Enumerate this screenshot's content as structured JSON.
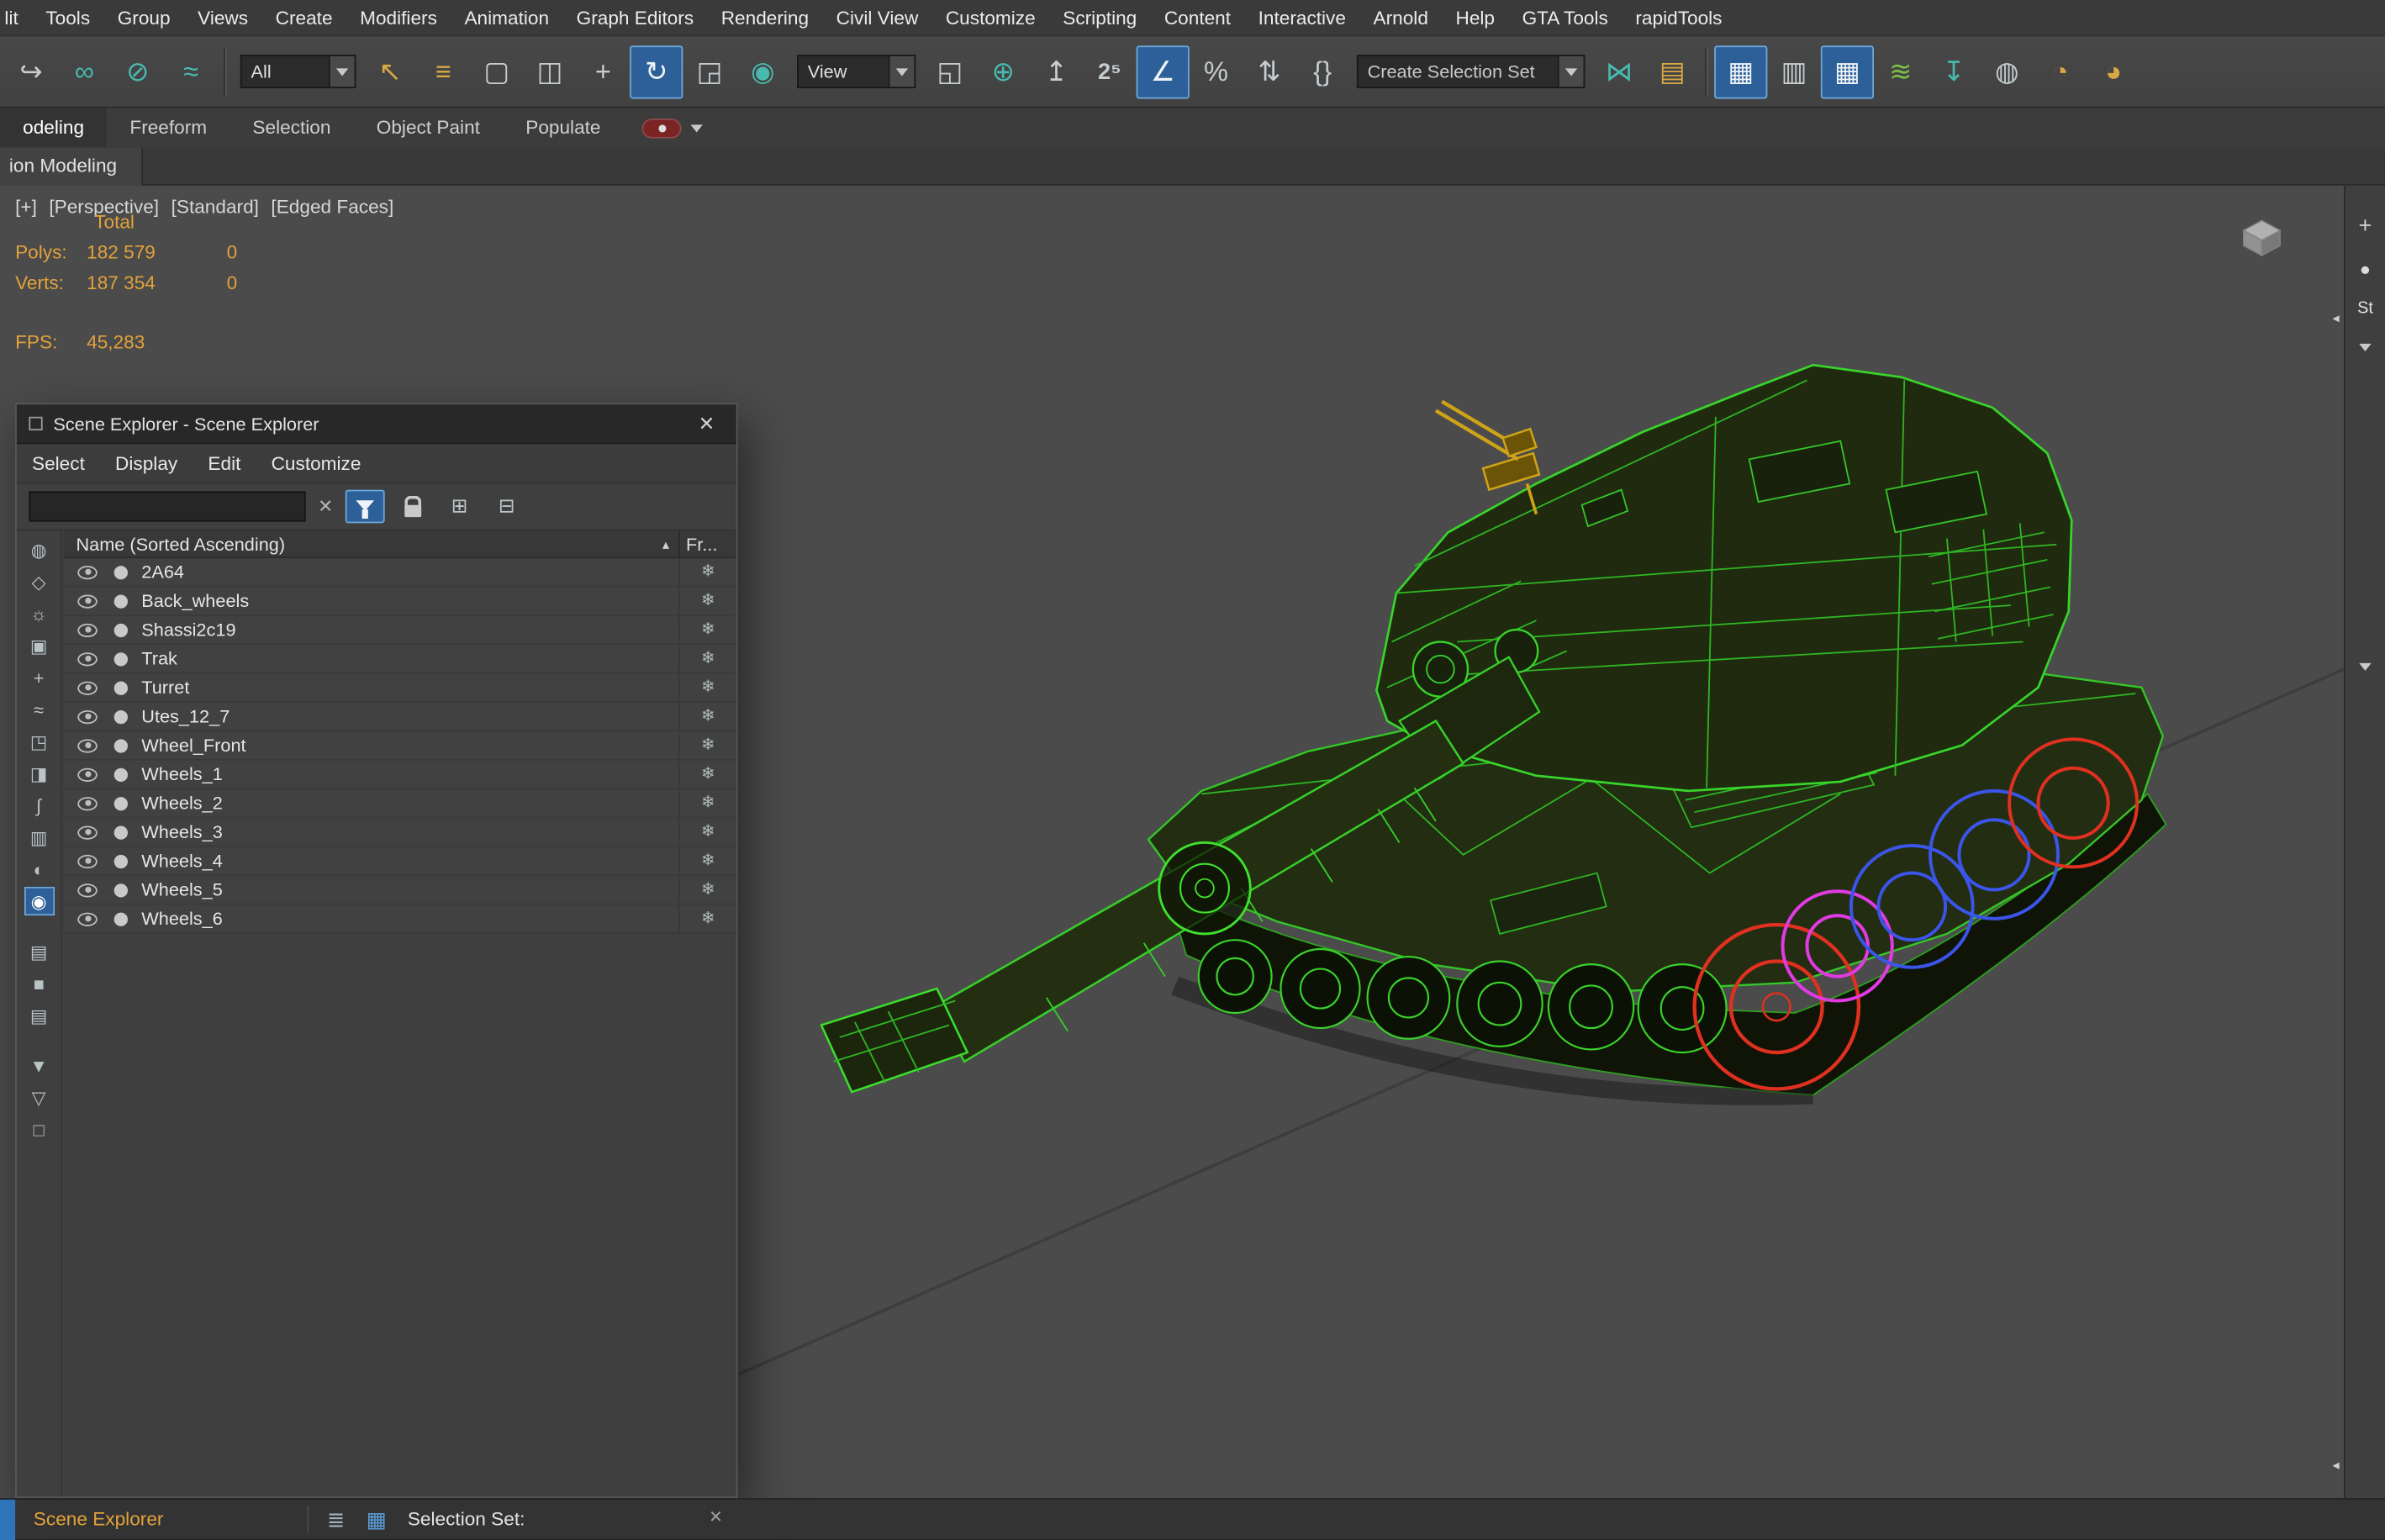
{
  "menubar": {
    "items": [
      "lit",
      "Tools",
      "Group",
      "Views",
      "Create",
      "Modifiers",
      "Animation",
      "Graph Editors",
      "Rendering",
      "Civil View",
      "Customize",
      "Scripting",
      "Content",
      "Interactive",
      "Arnold",
      "Help",
      "GTA Tools",
      "rapidTools"
    ]
  },
  "toolbar": {
    "group1": [
      {
        "name": "redo-icon",
        "glyph": "↪",
        "cls": ""
      },
      {
        "name": "select-and-link-icon",
        "glyph": "∞",
        "cls": "teal"
      },
      {
        "name": "unlink-selection-icon",
        "glyph": "⊘",
        "cls": "teal"
      },
      {
        "name": "bind-to-spacewarp-icon",
        "glyph": "≈",
        "cls": "teal"
      }
    ],
    "selection_filter_value": "All",
    "group2": [
      {
        "name": "select-object-icon",
        "glyph": "↖",
        "cls": "gold"
      },
      {
        "name": "select-by-name-icon",
        "glyph": "≡",
        "cls": "gold"
      },
      {
        "name": "rectangular-selection-region-icon",
        "glyph": "▢",
        "cls": ""
      },
      {
        "name": "window-crossing-icon",
        "glyph": "◫",
        "cls": ""
      },
      {
        "name": "select-and-move-icon",
        "glyph": "+",
        "cls": ""
      },
      {
        "name": "select-and-rotate-icon",
        "glyph": "↻",
        "cls": "active"
      },
      {
        "name": "select-and-scale-icon",
        "glyph": "◲",
        "cls": ""
      },
      {
        "name": "select-placement-icon",
        "glyph": "◉",
        "cls": "teal"
      }
    ],
    "coord_system_value": "View",
    "group3": [
      {
        "name": "use-pivot-point-center-icon",
        "glyph": "◱",
        "cls": ""
      },
      {
        "name": "select-and-manipulate-icon",
        "glyph": "⊕",
        "cls": "teal"
      },
      {
        "name": "keyboard-shortcut-override-icon",
        "glyph": "↥",
        "cls": ""
      },
      {
        "name": "snap-toggle-25-icon",
        "glyph": "2⁵",
        "cls": "snaplbl"
      },
      {
        "name": "angle-snap-icon",
        "glyph": "∠",
        "cls": "active"
      },
      {
        "name": "percent-snap-icon",
        "glyph": "%",
        "cls": ""
      },
      {
        "name": "spinner-snap-icon",
        "glyph": "⇅",
        "cls": ""
      },
      {
        "name": "named-selection-sets-icon",
        "glyph": "{}",
        "cls": ""
      }
    ],
    "selection_set_value": "Create Selection Set",
    "group4": [
      {
        "name": "mirror-icon",
        "glyph": "⋈",
        "cls": "teal"
      },
      {
        "name": "align-icon",
        "glyph": "▤",
        "cls": "gold"
      }
    ],
    "group5": [
      {
        "name": "scene-explorer-toggle-icon",
        "glyph": "▦",
        "cls": "active"
      },
      {
        "name": "layer-explorer-toggle-icon",
        "glyph": "▥",
        "cls": ""
      },
      {
        "name": "ribbon-toggle-icon",
        "glyph": "▦",
        "cls": "active"
      },
      {
        "name": "curve-editor-icon",
        "glyph": "≋",
        "cls": "green"
      },
      {
        "name": "schematic-view-icon",
        "glyph": "↧",
        "cls": "teal"
      },
      {
        "name": "material-editor-icon",
        "glyph": "◍",
        "cls": ""
      },
      {
        "name": "render-setup-icon",
        "glyph": "◔",
        "cls": "gold"
      },
      {
        "name": "rendered-frame-icon",
        "glyph": "◕",
        "cls": "gold"
      }
    ]
  },
  "ribbon": {
    "tabs": [
      {
        "label": "odeling",
        "cls": "active"
      },
      {
        "label": "Freeform",
        "cls": ""
      },
      {
        "label": "Selection",
        "cls": ""
      },
      {
        "label": "Object Paint",
        "cls": ""
      },
      {
        "label": "Populate",
        "cls": ""
      }
    ],
    "panel_tab": "ion Modeling"
  },
  "viewport": {
    "labels": {
      "general": "[+]",
      "pov": "[Perspective]",
      "style": "[Standard]",
      "shading": "[Edged Faces]"
    },
    "stats": {
      "total_header": "Total",
      "polys_label": "Polys:",
      "polys_total": "182 579",
      "polys_selected": "0",
      "verts_label": "Verts:",
      "verts_total": "187 354",
      "verts_selected": "0",
      "fps_label": "FPS:",
      "fps_value": "45,283"
    },
    "edge_arrow": "◂"
  },
  "scene_explorer": {
    "title": "Scene Explorer - Scene Explorer",
    "close_glyph": "✕",
    "menu": [
      "Select",
      "Display",
      "Edit",
      "Customize"
    ],
    "search_value": "",
    "clear_glyph": "✕",
    "tool_icons": [
      {
        "name": "select-children-toggle-icon",
        "glyph": "⊞"
      },
      {
        "name": "pick-parent-toggle-icon",
        "glyph": "⊟"
      }
    ],
    "header_name": "Name (Sorted Ascending)",
    "sort_arrow": "▴",
    "header_frozen": "Fr...",
    "freeze_glyph": "❄",
    "left_icons": [
      {
        "name": "display-geometry-icon",
        "glyph": "◍",
        "cls": ""
      },
      {
        "name": "display-shapes-icon",
        "glyph": "◇",
        "cls": ""
      },
      {
        "name": "display-lights-icon",
        "glyph": "☼",
        "cls": ""
      },
      {
        "name": "display-cameras-icon",
        "glyph": "▣",
        "cls": ""
      },
      {
        "name": "display-helpers-icon",
        "glyph": "+",
        "cls": ""
      },
      {
        "name": "display-spacewarps-icon",
        "glyph": "≈",
        "cls": ""
      },
      {
        "name": "display-groups-icon",
        "glyph": "◳",
        "cls": ""
      },
      {
        "name": "display-xrefs-icon",
        "glyph": "◨",
        "cls": ""
      },
      {
        "name": "display-bones-icon",
        "glyph": "∫",
        "cls": ""
      },
      {
        "name": "display-containers-icon",
        "glyph": "▥",
        "cls": ""
      },
      {
        "name": "display-materials-icon",
        "glyph": "◐",
        "cls": ""
      },
      {
        "name": "display-visibility-icon",
        "glyph": "◉",
        "cls": "active"
      },
      {
        "name": "list-view-icon",
        "glyph": "▤",
        "cls": "gap-top"
      },
      {
        "name": "detail-view-icon",
        "glyph": "■",
        "cls": ""
      },
      {
        "name": "hierarchy-view-icon",
        "glyph": "▤",
        "cls": ""
      },
      {
        "name": "filter-combinations-icon",
        "glyph": "▼",
        "cls": "gap-top"
      },
      {
        "name": "custom-filter-icon",
        "glyph": "▽",
        "cls": ""
      },
      {
        "name": "workspace-icon",
        "glyph": "□",
        "cls": ""
      }
    ],
    "rows": [
      "2A64",
      "Back_wheels",
      "Shassi2c19",
      "Trak",
      "Turret",
      "Utes_12_7",
      "Wheel_Front",
      "Wheels_1",
      "Wheels_2",
      "Wheels_3",
      "Wheels_4",
      "Wheels_5",
      "Wheels_6"
    ]
  },
  "bottom_bar": {
    "tab": "Scene Explorer",
    "icons": [
      {
        "name": "docked-panels-icon",
        "glyph": "≣"
      },
      {
        "name": "scene-explorer-dock-icon",
        "glyph": "▦"
      }
    ],
    "selection_set_label": "Selection Set:",
    "close_glyph": "✕"
  },
  "right_panel": {
    "create_glyph": "+",
    "geometry_glyph": "●",
    "category_label": "St"
  },
  "colors": {
    "active_blue": "#2d6098",
    "stats_orange": "#e2a23b",
    "wireframe_green": "#3bdd2b",
    "wheel_red": "#e03020",
    "wheel_blue": "#3b55e8",
    "wheel_magenta": "#e23ae2",
    "mg_yellow": "#cfa316",
    "dock_tab_orange": "#e2a23b",
    "viewport_background": "#4b4b4b"
  }
}
